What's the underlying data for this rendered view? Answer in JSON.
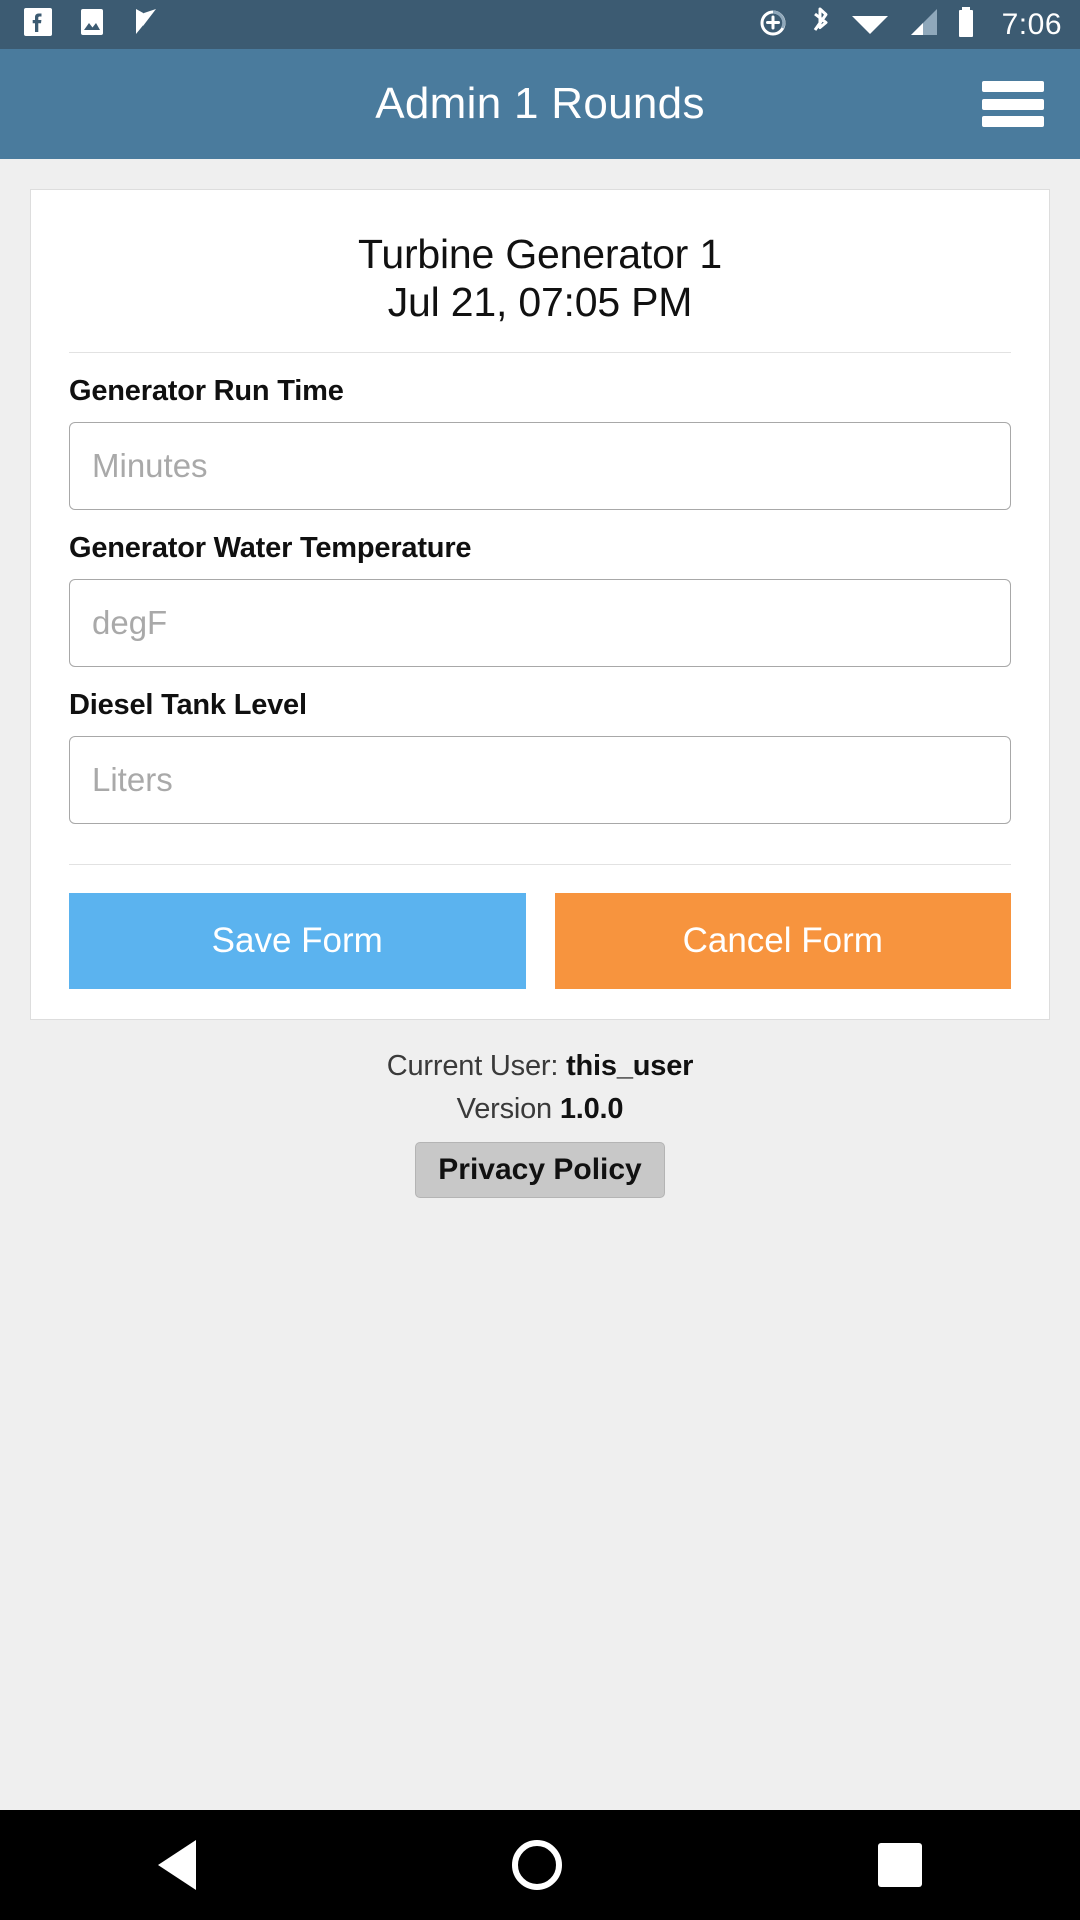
{
  "statusbar": {
    "left_icons": [
      "facebook-icon",
      "photo-icon",
      "checkmark-flag-icon"
    ],
    "right_icons": [
      "location-add-icon",
      "bluetooth-icon",
      "wifi-icon",
      "cellular-signal-icon",
      "battery-icon"
    ],
    "time": "7:06",
    "background": "#3c5b72"
  },
  "appbar": {
    "title": "Admin 1 Rounds",
    "menu_icon": "hamburger-menu-icon",
    "background": "#4a7b9d"
  },
  "card": {
    "title": "Turbine Generator 1",
    "subtitle": "Jul 21, 07:05 PM",
    "fields": [
      {
        "label": "Generator Run Time",
        "placeholder": "Minutes",
        "value": ""
      },
      {
        "label": "Generator Water Temperature",
        "placeholder": "degF",
        "value": ""
      },
      {
        "label": "Diesel Tank Level",
        "placeholder": "Liters",
        "value": ""
      }
    ],
    "buttons": {
      "save_label": "Save Form",
      "save_color": "#5bb3ef",
      "cancel_label": "Cancel Form",
      "cancel_color": "#f7943e"
    }
  },
  "footer": {
    "current_user_label": "Current User:",
    "current_user_value": "this_user",
    "version_label": "Version",
    "version_value": "1.0.0",
    "privacy_label": "Privacy Policy"
  },
  "navbar": {
    "back": "back-triangle-icon",
    "home": "home-circle-icon",
    "recents": "recents-square-icon"
  }
}
